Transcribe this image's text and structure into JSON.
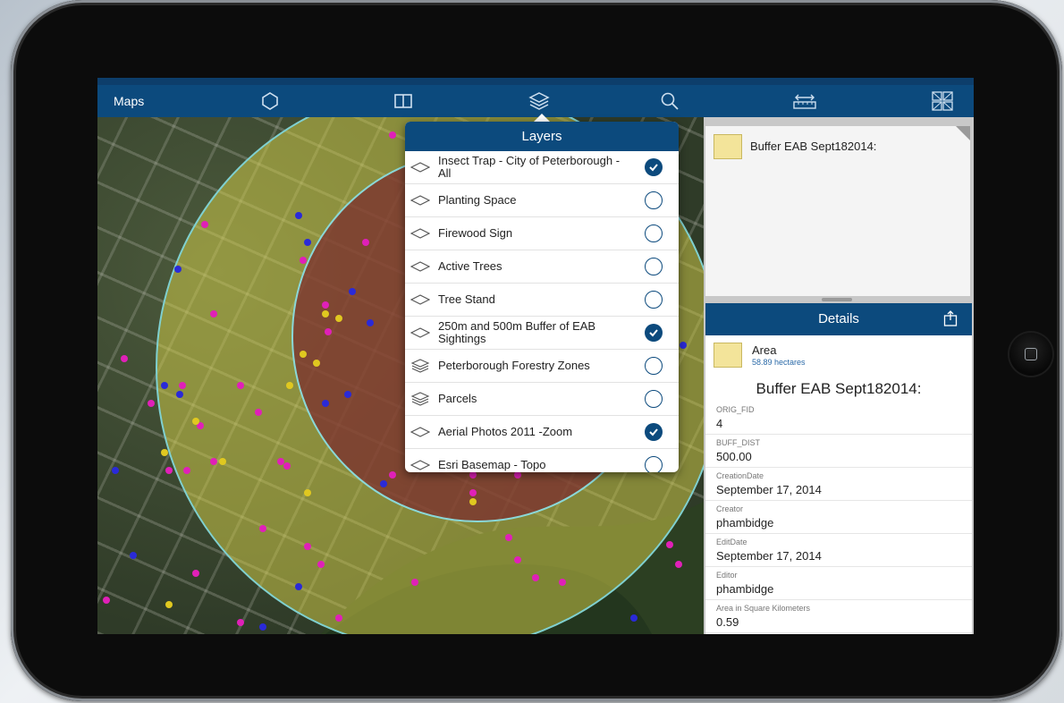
{
  "navbar": {
    "maps_label": "Maps",
    "icons": [
      "map-marker-icon",
      "bookmarks-icon",
      "layers-icon",
      "search-icon",
      "measure-icon",
      "basemap-gallery-icon"
    ]
  },
  "layers_panel": {
    "title": "Layers",
    "items": [
      {
        "label": "Insect Trap - City of Peterborough -All",
        "checked": true,
        "icon": "layer-icon"
      },
      {
        "label": "Planting Space",
        "checked": false,
        "icon": "layer-icon"
      },
      {
        "label": "Firewood Sign",
        "checked": false,
        "icon": "layer-icon"
      },
      {
        "label": "Active Trees",
        "checked": false,
        "icon": "layer-icon"
      },
      {
        "label": "Tree Stand",
        "checked": false,
        "icon": "layer-icon"
      },
      {
        "label": "250m and 500m Buffer of EAB Sightings",
        "checked": true,
        "icon": "layer-icon"
      },
      {
        "label": "Peterborough Forestry Zones",
        "checked": false,
        "icon": "layer-group-icon"
      },
      {
        "label": "Parcels",
        "checked": false,
        "icon": "layer-group-icon"
      },
      {
        "label": "Aerial Photos 2011 -Zoom",
        "checked": true,
        "icon": "layer-icon"
      },
      {
        "label": "Esri Basemap - Topo",
        "checked": false,
        "icon": "layer-icon"
      }
    ]
  },
  "popup": {
    "title": "Buffer EAB Sept182014:"
  },
  "details": {
    "title": "Details",
    "area_label": "Area",
    "area_value": "58.89 hectares",
    "feature_title": "Buffer EAB Sept182014:",
    "attributes": [
      {
        "key": "ORIG_FID",
        "value": "4"
      },
      {
        "key": "BUFF_DIST",
        "value": "500.00"
      },
      {
        "key": "CreationDate",
        "value": "September 17, 2014"
      },
      {
        "key": "Creator",
        "value": "phambidge"
      },
      {
        "key": "EditDate",
        "value": "September 17, 2014"
      },
      {
        "key": "Editor",
        "value": "phambidge"
      },
      {
        "key": "Area in Square Kilometers",
        "value": "0.59"
      }
    ]
  },
  "colors": {
    "nav_blue": "#0c4a7d",
    "buffer_outer": "#d9d34a",
    "buffer_inner": "#7a2a2e",
    "point_magenta": "#e020b8",
    "point_blue": "#2a2ad8",
    "point_yellow": "#e0c820"
  }
}
